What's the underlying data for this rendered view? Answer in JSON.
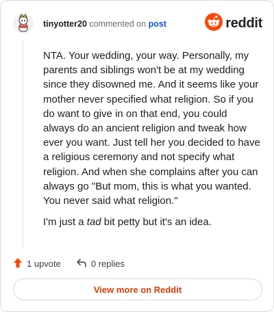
{
  "header": {
    "username": "tinyotter20",
    "action_text": "commented on",
    "post_link": "post",
    "brand": "reddit"
  },
  "comment": {
    "paragraph1": "NTA. Your wedding, your way. Personally, my parents and siblings won't be at my wedding since they disowned me. And it seems like your mother never specified what religion. So if you do want to give in on that end, you could always do an ancient religion and tweak how ever you want. Just tell her you decided to have a religious ceremony and not specify what religion. And when she complains after you can always go \"But mom, this is what you wanted. You never said what religion.\"",
    "paragraph2_before": "I'm just a ",
    "paragraph2_emphasis": "tad",
    "paragraph2_after": " bit petty but it's an idea."
  },
  "footer": {
    "upvotes": "1 upvote",
    "replies": "0 replies",
    "view_button": "View more on Reddit"
  },
  "colors": {
    "accent": "#ff4500",
    "link": "#0a58ca",
    "button_text": "#d93a00"
  },
  "icons": {
    "avatar": "avatar",
    "logo": "reddit-alien-icon",
    "upvote": "upvote-arrow-icon",
    "reply": "reply-arrow-icon"
  }
}
